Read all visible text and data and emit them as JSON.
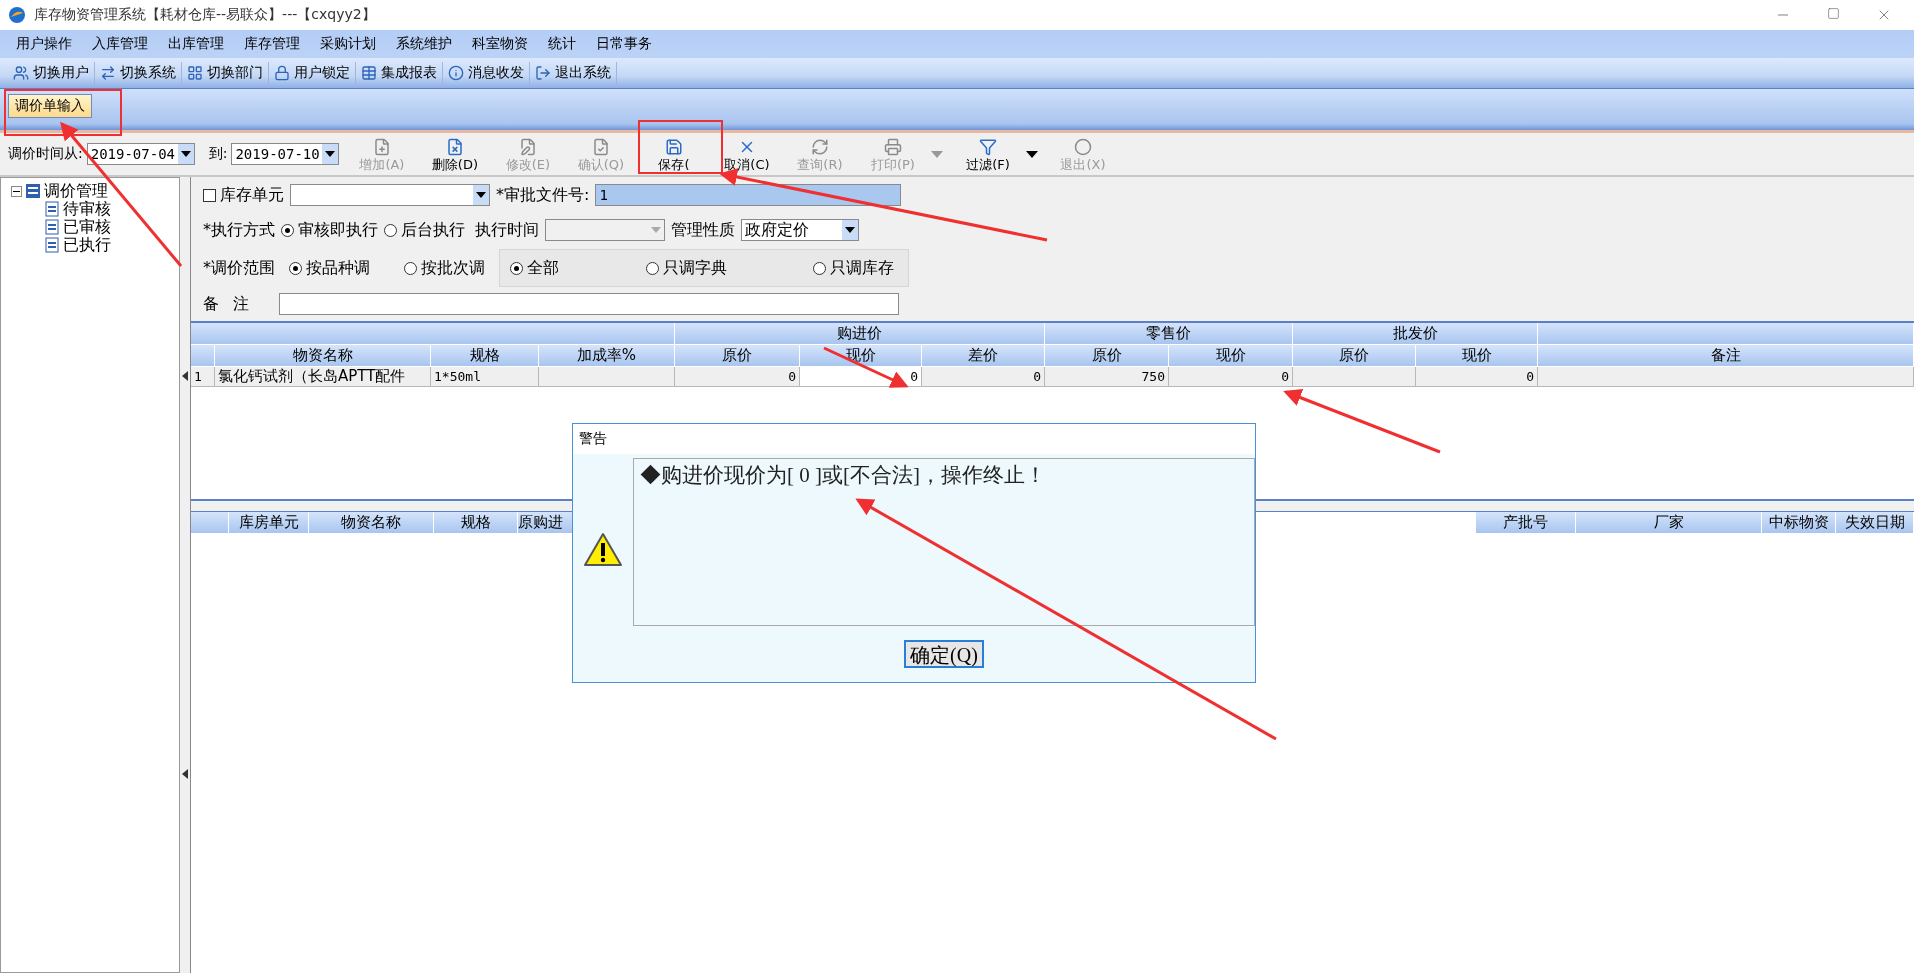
{
  "window": {
    "title": "库存物资管理系统【耗材仓库--易联众】---【cxqyy2】"
  },
  "menu": [
    "用户操作",
    "入库管理",
    "出库管理",
    "库存管理",
    "采购计划",
    "系统维护",
    "科室物资",
    "统计",
    "日常事务"
  ],
  "toolbar": [
    "切换用户",
    "切换系统",
    "切换部门",
    "用户锁定",
    "集成报表",
    "消息收发",
    "退出系统"
  ],
  "tabs": [
    {
      "label": "调价单输入",
      "selected": true
    }
  ],
  "command_bar": {
    "date_from_label": "调价时间从:",
    "date_from": "2019-07-04",
    "date_to_label": "到:",
    "date_to": "2019-07-10",
    "buttons": [
      {
        "label": "增加(A)",
        "disabled": true,
        "has_menu": false
      },
      {
        "label": "删除(D)",
        "disabled": false,
        "has_menu": false
      },
      {
        "label": "修改(E)",
        "disabled": true,
        "has_menu": false
      },
      {
        "label": "确认(Q)",
        "disabled": true,
        "has_menu": false
      },
      {
        "label": "保存(",
        "disabled": false,
        "has_menu": false
      },
      {
        "label": "取消(C)",
        "disabled": false,
        "has_menu": false
      },
      {
        "label": "查询(R)",
        "disabled": true,
        "has_menu": false
      },
      {
        "label": "打印(P)",
        "disabled": true,
        "has_menu": true
      },
      {
        "label": "过滤(F)",
        "disabled": false,
        "has_menu": true
      },
      {
        "label": "退出(X)",
        "disabled": true,
        "has_menu": false
      }
    ]
  },
  "tree": {
    "label": "调价管理",
    "expanded": true,
    "children": [
      {
        "label": "待审核"
      },
      {
        "label": "已审核"
      },
      {
        "label": "已执行"
      }
    ]
  },
  "form": {
    "store_unit": {
      "label": "库存单元",
      "checked": false
    },
    "approval_no": {
      "label": "*审批文件号:",
      "value": "1"
    },
    "exec_mode": {
      "label": "*执行方式",
      "options": [
        {
          "label": "审核即执行",
          "selected": true
        },
        {
          "label": "后台执行",
          "selected": false
        }
      ]
    },
    "exec_time": {
      "label": "执行时间"
    },
    "mgmt": {
      "label": "管理性质",
      "value": "政府定价"
    },
    "scope": {
      "label": "*调价范围",
      "options": [
        {
          "label": "按品种调",
          "selected": true
        },
        {
          "label": "按批次调",
          "selected": false
        }
      ]
    },
    "range": [
      {
        "label": "全部",
        "selected": true
      },
      {
        "label": "只调字典",
        "selected": false
      },
      {
        "label": "只调库存",
        "selected": false
      }
    ],
    "remark": {
      "label_1": "备",
      "label_2": "注"
    }
  },
  "price_grid": {
    "groups": [
      {
        "label": "购进价"
      },
      {
        "label": "零售价"
      },
      {
        "label": "批发价"
      }
    ],
    "columns": [
      "物资名称",
      "规格",
      "加成率%",
      "原价",
      "现价",
      "差价",
      "原价",
      "现价",
      "原价",
      "现价",
      "备注"
    ],
    "rows": [
      {
        "index": "1",
        "cells": [
          "氯化钙试剂（长岛APTT配件",
          "1*50ml",
          "",
          "0",
          "0",
          "0",
          "750",
          "0",
          "",
          "0",
          ""
        ]
      }
    ]
  },
  "detail_grid": {
    "columns": [
      "库房单元",
      "物资名称",
      "规格",
      "原购进"
    ],
    "columns_right": [
      "产批号",
      "厂家",
      "中标物资",
      "失效日期"
    ]
  },
  "dialog": {
    "title": "警告",
    "message": "◆购进价现价为[ 0 ]或[不合法]，操作终止！",
    "button": "确定(Q)"
  }
}
